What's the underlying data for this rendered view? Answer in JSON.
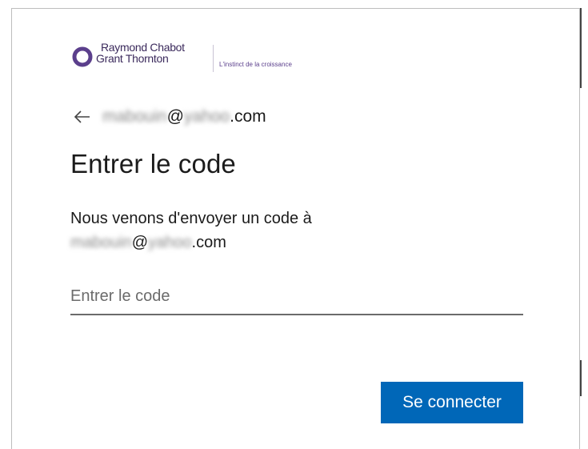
{
  "brand": {
    "name_line1": "Raymond Chabot",
    "name_line2": "Grant Thornton",
    "tagline": "L'instinct de la croissance"
  },
  "identity": {
    "email_local_blurred": "mabouin",
    "at": "@",
    "email_domain_blurred": "yahoo",
    "email_tld": ".com"
  },
  "page": {
    "title": "Entrer le code",
    "description_line1": "Nous venons d'envoyer un code à",
    "description_email_local_blurred": "mabouin",
    "description_at": "@",
    "description_email_domain_blurred": "yahoo",
    "description_email_tld": ".com"
  },
  "code_field": {
    "placeholder": "Entrer le code",
    "value": ""
  },
  "actions": {
    "submit_label": "Se connecter"
  },
  "colors": {
    "primary_button": "#0067b8",
    "logo_accent": "#5b3f8c"
  },
  "icons": {
    "back": "arrow-left-icon",
    "logo": "logo-ring-icon"
  }
}
